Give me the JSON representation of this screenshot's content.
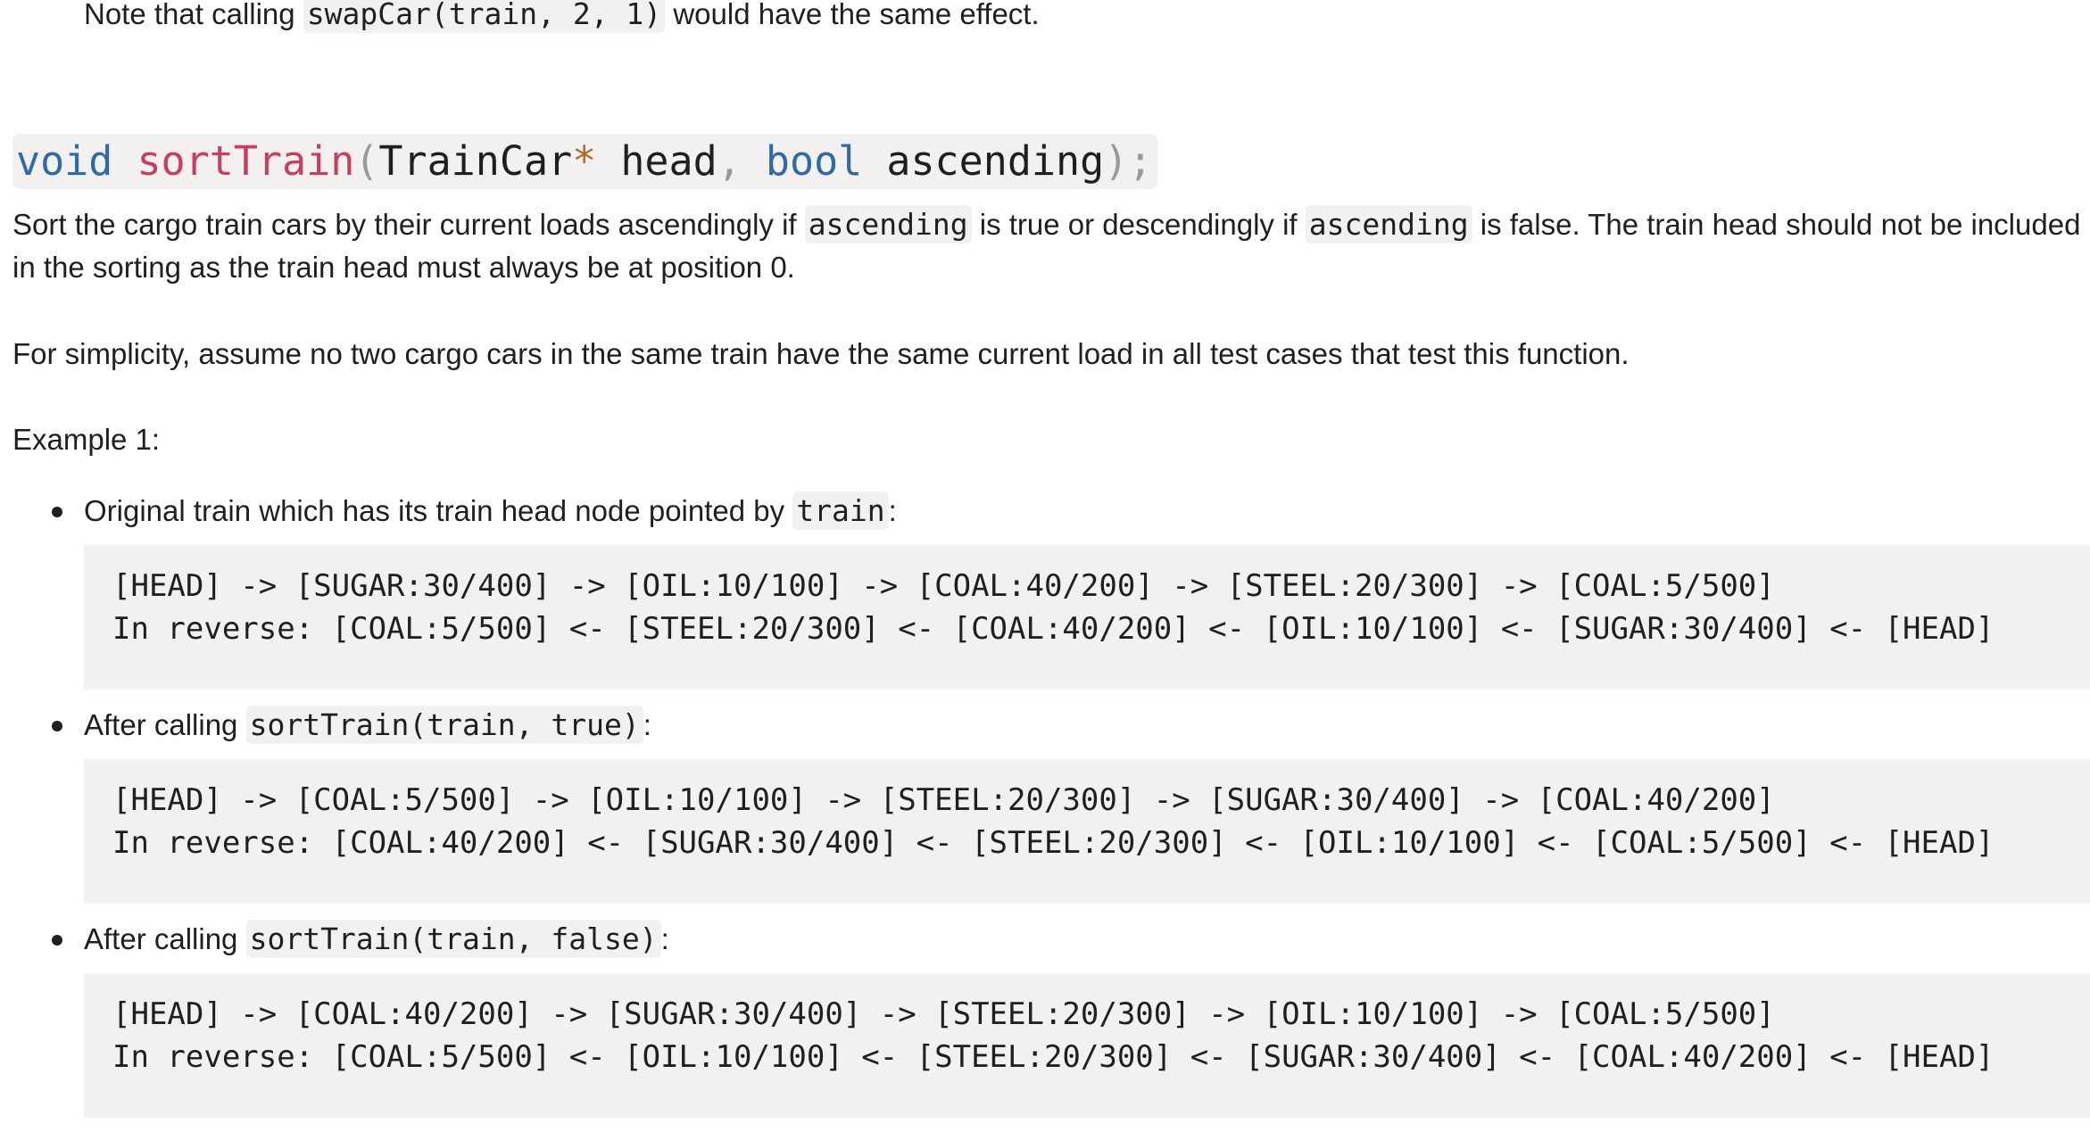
{
  "top_note": {
    "prefix": "Note that calling ",
    "code": "swapCar(train, 2, 1)",
    "suffix": " would have the same effect."
  },
  "signature": {
    "return_type": "void",
    "name": "sortTrain",
    "open_paren": "(",
    "param1_type": "TrainCar",
    "pointer": "*",
    "param1_name": "head",
    "comma": ",",
    "param2_type": "bool",
    "param2_name": "ascending",
    "close": ");"
  },
  "description": {
    "part1": "Sort the cargo train cars by their current loads ascendingly if ",
    "code1": "ascending",
    "part2": " is true or descendingly if ",
    "code2": "ascending",
    "part3": " is false. The train head should not be included in the sorting as the train head must always be at position 0."
  },
  "simplicity_note": "For simplicity, assume no two cargo cars in the same train have the same current load in all test cases that test this function.",
  "example_label": "Example 1:",
  "examples": [
    {
      "prefix": "Original train which has its train head node pointed by ",
      "code": "train",
      "suffix": ":",
      "forward": "[HEAD] -> [SUGAR:30/400] -> [OIL:10/100] -> [COAL:40/200] -> [STEEL:20/300] -> [COAL:5/500]",
      "reverse": "In reverse: [COAL:5/500] <- [STEEL:20/300] <- [COAL:40/200] <- [OIL:10/100] <- [SUGAR:30/400] <- [HEAD]"
    },
    {
      "prefix": "After calling ",
      "code": "sortTrain(train, true)",
      "suffix": ":",
      "forward": "[HEAD] -> [COAL:5/500] -> [OIL:10/100] -> [STEEL:20/300] -> [SUGAR:30/400] -> [COAL:40/200]",
      "reverse": "In reverse: [COAL:40/200] <- [SUGAR:30/400] <- [STEEL:20/300] <- [OIL:10/100] <- [COAL:5/500] <- [HEAD]"
    },
    {
      "prefix": "After calling ",
      "code": "sortTrain(train, false)",
      "suffix": ":",
      "forward": "[HEAD] -> [COAL:40/200] -> [SUGAR:30/400] -> [STEEL:20/300] -> [OIL:10/100] -> [COAL:5/500]",
      "reverse": "In reverse: [COAL:5/500] <- [OIL:10/100] <- [STEEL:20/300] <- [SUGAR:30/400] <- [COAL:40/200] <- [HEAD]"
    }
  ]
}
